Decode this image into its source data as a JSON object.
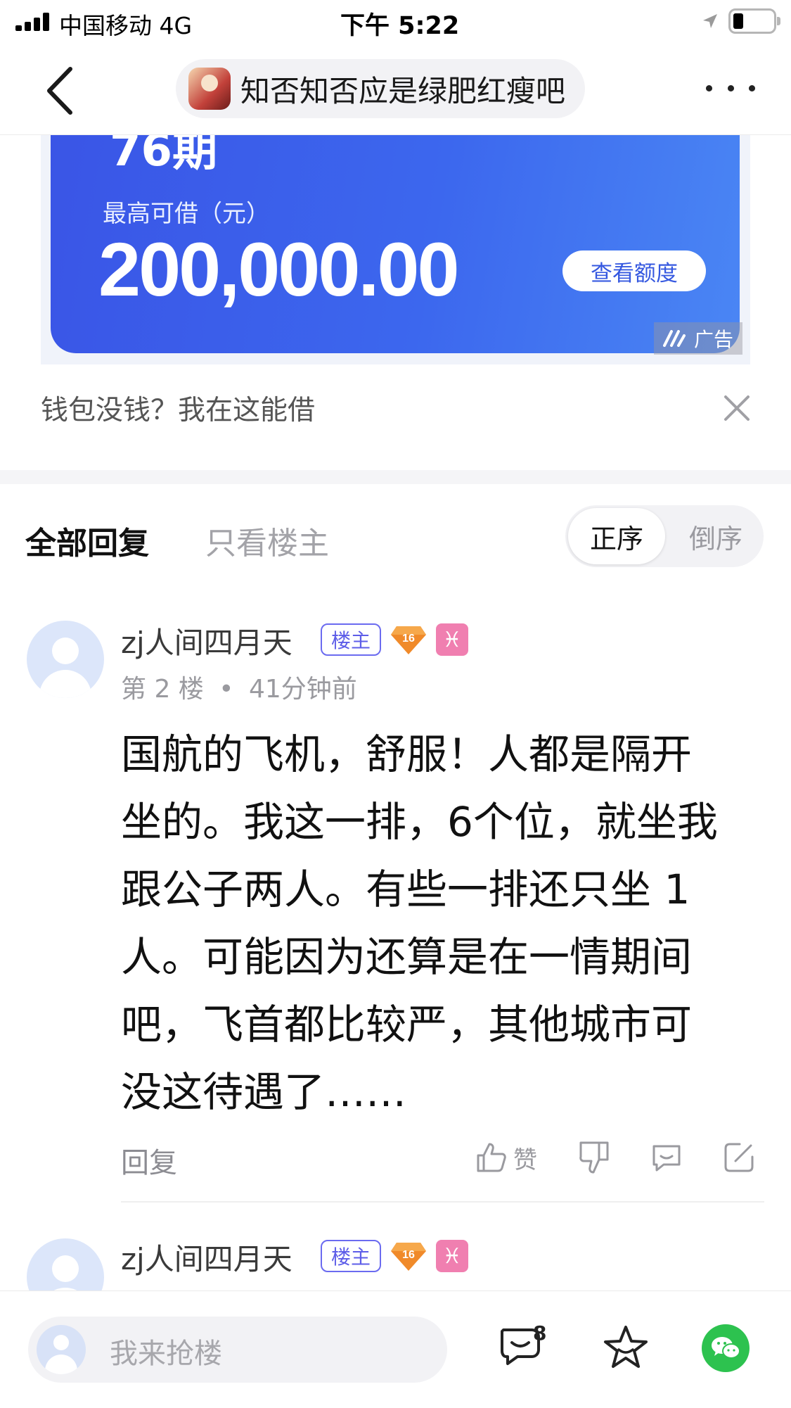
{
  "status_bar": {
    "carrier": "中国移动  4G",
    "time": "下午 5:22",
    "battery_level": 0.25
  },
  "nav": {
    "forum_name": "知否知否应是绿肥红瘦吧"
  },
  "ad": {
    "term_fragment": "76期",
    "max_label": "最高可借（元）",
    "amount": "200,000.00",
    "cta": "查看额度",
    "badge": "广告",
    "caption": "钱包没钱？我在这能借"
  },
  "tabs": {
    "all": "全部回复",
    "op_only": "只看楼主",
    "sort_asc": "正序",
    "sort_desc": "倒序"
  },
  "posts": [
    {
      "username": "zj人间四月天",
      "op_badge": "楼主",
      "level": "16",
      "zodiac": "♓",
      "floor": "第 2 楼",
      "time_ago": "41分钟前",
      "content": [
        "国航的飞机，舒服！人都是隔开",
        "坐的。我这一排，6个位，就坐我",
        "跟公子两人。有些一排还只坐 1",
        "人。可能因为还算是在一情期间",
        "吧，飞首都比较严，其他城市可",
        "没这待遇了……"
      ],
      "reply_label": "回复",
      "like_label": "赞"
    },
    {
      "username": "zj人间四月天",
      "op_badge": "楼主",
      "level": "16",
      "zodiac": "♓"
    }
  ],
  "bottom_bar": {
    "reply_placeholder": "我来抢楼",
    "comment_count": "8"
  },
  "colors": {
    "ad_gradient_start": "#3a55e6",
    "ad_gradient_end": "#4a86f4",
    "op_badge": "#5d5de8",
    "zodiac_badge": "#f07fb0",
    "level_badge": "#f08a2a",
    "wechat_green": "#2dc24f"
  },
  "icons": {
    "back": "chevron-left-icon",
    "more": "more-dots-icon",
    "close": "close-icon",
    "like": "thumbs-up-icon",
    "dislike": "thumbs-down-icon",
    "comment": "comment-bubble-icon",
    "share": "share-edit-icon",
    "favorite": "star-icon",
    "wechat": "wechat-icon"
  }
}
